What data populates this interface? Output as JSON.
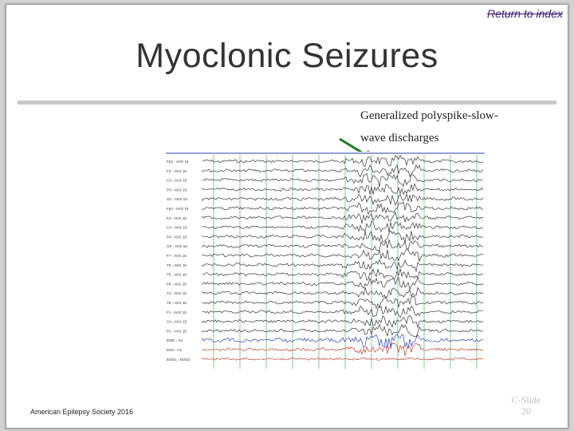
{
  "slide": {
    "return_link": "Return to index",
    "title": "Myoclonic Seizures",
    "annotation_line1": "Generalized polyspike-slow-",
    "annotation_line2": "wave discharges",
    "footer": "American Epilepsy Society 2016",
    "slide_number_label": "C-Slide",
    "slide_number": "20"
  },
  "eeg": {
    "channel_labels": [
      "Fp1 - AVG 15",
      "F3 - AVG 15",
      "C3 - AVG 15",
      "P3 - AVG 15",
      "O1 - AVG 15",
      "Fp2 - AVG 15",
      "F4 - AVG 15",
      "C4 - AVG 15",
      "P4 - AVG 15",
      "O2 - AVG 15",
      "F7 - AVG 15",
      "T3 - AVG 15",
      "T5 - AVG 15",
      "F8 - AVG 15",
      "T4 - AVG 15",
      "T6 - AVG 15",
      "Fz - AVG 15",
      "Cz - AVG 15",
      "Pz - AVG 15",
      "EMG - A2",
      "EKG - A1",
      "EOG1 - EOG2"
    ],
    "colors": {
      "trace": "#333333",
      "emg": "#2a3fb0",
      "ekg": "#c0392b",
      "gridline": "#3cb04a",
      "top_line": "#2a3fb0",
      "arrow": "#1f7a1f"
    }
  }
}
